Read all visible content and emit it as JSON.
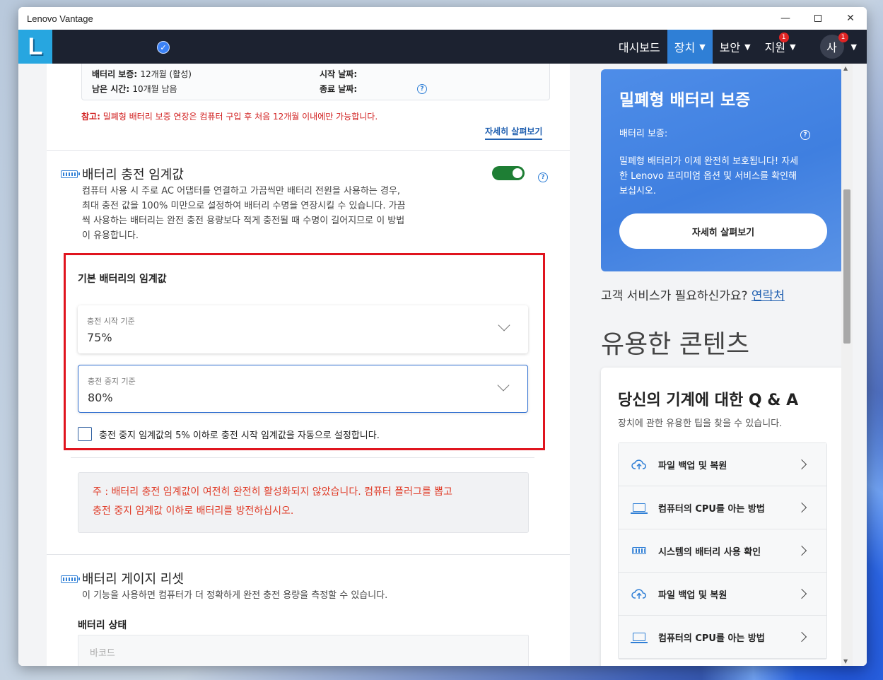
{
  "window": {
    "title": "Lenovo Vantage",
    "minimize": "—",
    "close": "✕"
  },
  "appbar": {
    "logo": "L",
    "check": "✓",
    "nav": [
      {
        "label": "대시보드",
        "active": false
      },
      {
        "label": "장치",
        "active": true
      },
      {
        "label": "보안",
        "active": false
      },
      {
        "label": "지원",
        "active": false,
        "badge": "1"
      }
    ],
    "user": {
      "initial": "사",
      "badge": "1"
    },
    "chevron": "⌄"
  },
  "warranty_box": {
    "label1": "배터리 보증:",
    "value1": "12개월 (활성)",
    "label2": "남은 시간:",
    "value2": "10개월 남음",
    "start_label": "시작 날짜:",
    "end_label": "종료 날짜:",
    "help": "?"
  },
  "note": {
    "prefix": "참고:",
    "text": " 밀폐형 배터리 보증 연장은 컴퓨터 구입 후 처음 12개월 이내에만 가능합니다."
  },
  "learn_more": "자세히 살펴보기",
  "charge_threshold": {
    "title": "배터리 충전 임계값",
    "desc_lines": [
      "컴퓨터 사용 시 주로 AC 어댑터를 연결하고 가끔씩만 배터리 전원을 사용하는 경우,",
      "최대 충전 값을 100% 미만으로 설정하여 배터리 수명을 연장시킬 수 있습니다. 가끔",
      "씩 사용하는 배터리는 완전 충전 용량보다 적게 충전될 때 수명이 길어지므로 이 방법",
      "이 유용합니다."
    ],
    "toggle_on": true,
    "help": "?"
  },
  "basic_threshold": {
    "title": "기본 배터리의 임계값",
    "start": {
      "label": "충전 시작 기준",
      "value": "75%"
    },
    "stop": {
      "label": "충전 중지 기준",
      "value": "80%"
    },
    "auto_checkbox": "충전 중지 임계값의 5% 이하로 충전 시작 임계값을 자동으로 설정합니다."
  },
  "warning": {
    "line1": "주 : 배터리 충전 임계값이 여전히 완전히 활성화되지 않았습니다. 컴퓨터 플러그를 뽑고",
    "line2": "충전 중지 임계값 이하로 배터리를 방전하십시오."
  },
  "gauge_reset": {
    "title": "배터리 게이지 리셋",
    "desc": "이 기능을 사용하면 컴퓨터가 더 정확하게 완전 충전 용량을 측정할 수 있습니다.",
    "status_label": "배터리 상태",
    "field_placeholder": "바코드"
  },
  "promo": {
    "title": "밀폐형 배터리 보증",
    "warranty_label": "배터리 보증:",
    "help": "?",
    "desc_lines": [
      "밀폐형 배터리가 이제 완전히 보호됩니다! 자세",
      "한 Lenovo 프리미엄 옵션 및 서비스를 확인해",
      "보십시오."
    ],
    "button": "자세히 살펴보기"
  },
  "customer_service": {
    "text": "고객 서비스가 필요하신가요? ",
    "link": "연락처"
  },
  "useful_title": "유용한 콘텐츠",
  "qa": {
    "title": "당신의 기계에 대한 Q & A",
    "subtitle": "장치에 관한 유용한 팁을 찾을 수 있습니다.",
    "items": [
      {
        "icon": "cloud-upload-icon",
        "label": "파일 백업 및 복원"
      },
      {
        "icon": "laptop-icon",
        "label": "컴퓨터의 CPU를 아는 방법"
      },
      {
        "icon": "battery-icon",
        "label": "시스템의 배터리 사용 확인"
      },
      {
        "icon": "cloud-upload-icon",
        "label": "파일 백업 및 복원"
      },
      {
        "icon": "laptop-icon",
        "label": "컴퓨터의 CPU를 아는 방법"
      }
    ]
  },
  "colors": {
    "accent": "#2f7fd6",
    "appbar": "#1c2230",
    "warning_red": "#d11f1f",
    "toggle_on": "#1e7e34",
    "highlight_frame": "#e0141e"
  }
}
